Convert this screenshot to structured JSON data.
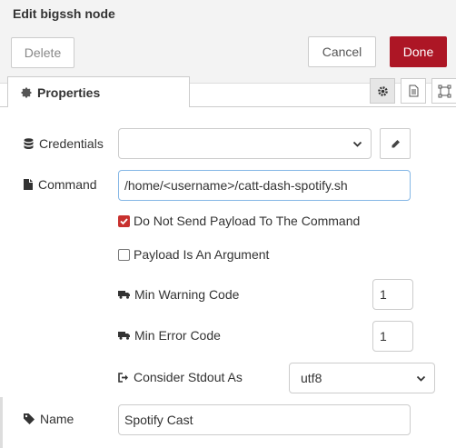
{
  "header": {
    "title": "Edit bigssh node",
    "delete_label": "Delete",
    "cancel_label": "Cancel",
    "done_label": "Done"
  },
  "tabs": {
    "properties_label": "Properties",
    "icons": [
      "gear-icon",
      "description-icon",
      "appearance-icon"
    ]
  },
  "form": {
    "credentials": {
      "label": "Credentials",
      "value": ""
    },
    "command": {
      "label": "Command",
      "value": "/home/<username>/catt-dash-spotify.sh"
    },
    "no_payload": {
      "label": "Do Not Send Payload To The Command",
      "checked": true
    },
    "payload_arg": {
      "label": "Payload Is An Argument",
      "checked": false
    },
    "min_warning": {
      "label": "Min Warning Code",
      "value": "1"
    },
    "min_error": {
      "label": "Min Error Code",
      "value": "1"
    },
    "stdout": {
      "label": "Consider Stdout As",
      "value": "utf8"
    },
    "name": {
      "label": "Name",
      "value": "Spotify Cast"
    }
  },
  "colors": {
    "done": "#ad1625",
    "checked": "#c8312e",
    "focus_border": "#85b7e6"
  }
}
